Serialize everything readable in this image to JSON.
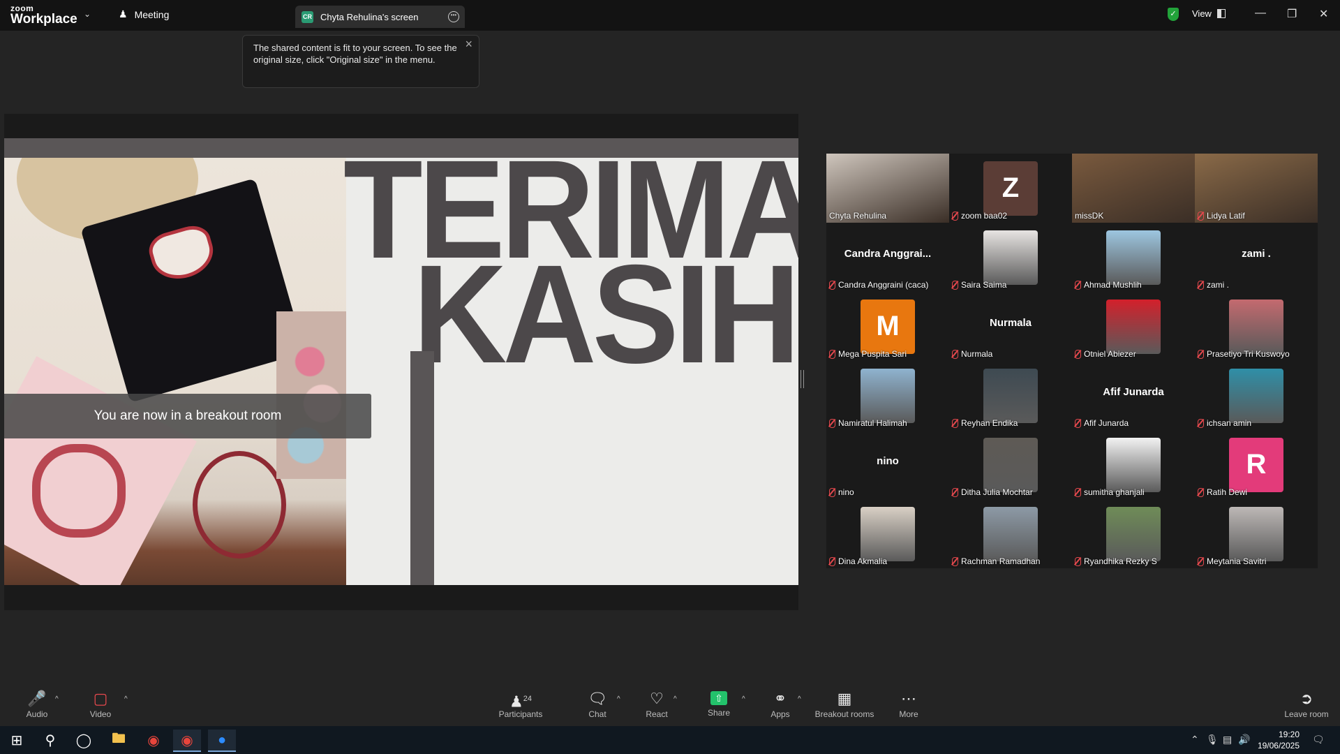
{
  "titlebar": {
    "logo_top": "zoom",
    "logo_bottom": "Workplace",
    "meeting_label": "Meeting",
    "screen_tab_badge": "CR",
    "screen_tab_label": "Chyta Rehulina's screen",
    "view_label": "View"
  },
  "tooltip": {
    "text": "The shared content is fit to your screen. To see the original size, click \"Original size\" in the menu."
  },
  "slide": {
    "line1": "TERIMA",
    "line2": "KASIH"
  },
  "breakout_banner": "You are now in a breakout room",
  "participants": [
    {
      "name": "Chyta Rehulina",
      "type": "video",
      "muted": false,
      "active": true,
      "color": "#cfc6bd"
    },
    {
      "name": "zoom baa02",
      "type": "letter",
      "letter": "Z",
      "muted": true,
      "color": "#5b3d36"
    },
    {
      "name": "missDK",
      "type": "video",
      "muted": false,
      "color": "#7a5a3e"
    },
    {
      "name": "Lidya Latif",
      "type": "video",
      "muted": true,
      "color": "#8a6a48"
    },
    {
      "name": "Candra Anggraini (caca)",
      "type": "text",
      "display": "Candra  Anggrai...",
      "muted": true
    },
    {
      "name": "Saira Saima",
      "type": "photo",
      "muted": true,
      "color": "#e7e4e2"
    },
    {
      "name": "Ahmad Mushlih",
      "type": "photo",
      "muted": true,
      "color": "#9dc6e0"
    },
    {
      "name": "zami .",
      "type": "text",
      "display": "zami .",
      "muted": true
    },
    {
      "name": "Mega Puspita Sari",
      "type": "letter",
      "letter": "M",
      "muted": true,
      "color": "#e8770f"
    },
    {
      "name": "Nurmala",
      "type": "text",
      "display": "Nurmala",
      "muted": true
    },
    {
      "name": "Otniel Abiezer",
      "type": "photo",
      "muted": true,
      "color": "#d3202b"
    },
    {
      "name": "Prasetiyo Tri Kuswoyo",
      "type": "photo",
      "muted": true,
      "color": "#c46a6f"
    },
    {
      "name": "Namiratul Halimah",
      "type": "photo",
      "muted": true,
      "color": "#8fb3cf"
    },
    {
      "name": "Reyhan Endika",
      "type": "photo",
      "muted": true,
      "color": "#3e4a52"
    },
    {
      "name": "Afif Junarda",
      "type": "text",
      "display": "Afif Junarda",
      "muted": true
    },
    {
      "name": "ichsan amin",
      "type": "photo",
      "muted": true,
      "color": "#2f8fa8"
    },
    {
      "name": "nino",
      "type": "text",
      "display": "nino",
      "muted": true
    },
    {
      "name": "Ditha Julia Mochtar",
      "type": "photo",
      "muted": true,
      "color": "#5e5a55"
    },
    {
      "name": "sumitha ghanjali",
      "type": "photo",
      "muted": true,
      "color": "#f2f2f2"
    },
    {
      "name": "Ratih Dewi",
      "type": "letter",
      "letter": "R",
      "muted": true,
      "color": "#e33b7a"
    },
    {
      "name": "Dina Akmalia",
      "type": "photo",
      "muted": true,
      "color": "#d9d0c5"
    },
    {
      "name": "Rachman Ramadhan",
      "type": "photo",
      "muted": true,
      "color": "#8d9aa6"
    },
    {
      "name": "Ryandhika Rezky S",
      "type": "photo",
      "muted": true,
      "color": "#6f8c58"
    },
    {
      "name": "Meytania Savitri",
      "type": "photo",
      "muted": true,
      "color": "#bdb8b6"
    }
  ],
  "toolbar": {
    "audio": "Audio",
    "video": "Video",
    "participants": "Participants",
    "participants_count": "24",
    "chat": "Chat",
    "react": "React",
    "share": "Share",
    "apps": "Apps",
    "breakout": "Breakout rooms",
    "more": "More",
    "leave": "Leave room"
  },
  "taskbar": {
    "time": "19:20",
    "date": "19/06/2025"
  }
}
